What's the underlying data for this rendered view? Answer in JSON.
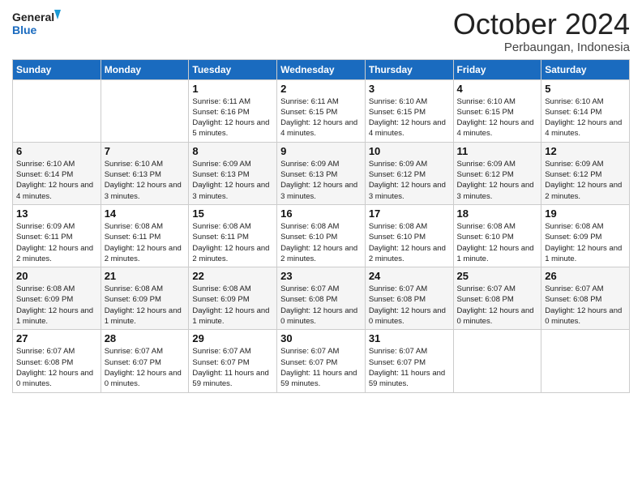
{
  "logo": {
    "line1": "General",
    "line2": "Blue"
  },
  "header": {
    "month": "October 2024",
    "location": "Perbaungan, Indonesia"
  },
  "weekdays": [
    "Sunday",
    "Monday",
    "Tuesday",
    "Wednesday",
    "Thursday",
    "Friday",
    "Saturday"
  ],
  "weeks": [
    [
      {
        "day": "",
        "info": ""
      },
      {
        "day": "",
        "info": ""
      },
      {
        "day": "1",
        "info": "Sunrise: 6:11 AM\nSunset: 6:16 PM\nDaylight: 12 hours and 5 minutes."
      },
      {
        "day": "2",
        "info": "Sunrise: 6:11 AM\nSunset: 6:15 PM\nDaylight: 12 hours and 4 minutes."
      },
      {
        "day": "3",
        "info": "Sunrise: 6:10 AM\nSunset: 6:15 PM\nDaylight: 12 hours and 4 minutes."
      },
      {
        "day": "4",
        "info": "Sunrise: 6:10 AM\nSunset: 6:15 PM\nDaylight: 12 hours and 4 minutes."
      },
      {
        "day": "5",
        "info": "Sunrise: 6:10 AM\nSunset: 6:14 PM\nDaylight: 12 hours and 4 minutes."
      }
    ],
    [
      {
        "day": "6",
        "info": "Sunrise: 6:10 AM\nSunset: 6:14 PM\nDaylight: 12 hours and 4 minutes."
      },
      {
        "day": "7",
        "info": "Sunrise: 6:10 AM\nSunset: 6:13 PM\nDaylight: 12 hours and 3 minutes."
      },
      {
        "day": "8",
        "info": "Sunrise: 6:09 AM\nSunset: 6:13 PM\nDaylight: 12 hours and 3 minutes."
      },
      {
        "day": "9",
        "info": "Sunrise: 6:09 AM\nSunset: 6:13 PM\nDaylight: 12 hours and 3 minutes."
      },
      {
        "day": "10",
        "info": "Sunrise: 6:09 AM\nSunset: 6:12 PM\nDaylight: 12 hours and 3 minutes."
      },
      {
        "day": "11",
        "info": "Sunrise: 6:09 AM\nSunset: 6:12 PM\nDaylight: 12 hours and 3 minutes."
      },
      {
        "day": "12",
        "info": "Sunrise: 6:09 AM\nSunset: 6:12 PM\nDaylight: 12 hours and 2 minutes."
      }
    ],
    [
      {
        "day": "13",
        "info": "Sunrise: 6:09 AM\nSunset: 6:11 PM\nDaylight: 12 hours and 2 minutes."
      },
      {
        "day": "14",
        "info": "Sunrise: 6:08 AM\nSunset: 6:11 PM\nDaylight: 12 hours and 2 minutes."
      },
      {
        "day": "15",
        "info": "Sunrise: 6:08 AM\nSunset: 6:11 PM\nDaylight: 12 hours and 2 minutes."
      },
      {
        "day": "16",
        "info": "Sunrise: 6:08 AM\nSunset: 6:10 PM\nDaylight: 12 hours and 2 minutes."
      },
      {
        "day": "17",
        "info": "Sunrise: 6:08 AM\nSunset: 6:10 PM\nDaylight: 12 hours and 2 minutes."
      },
      {
        "day": "18",
        "info": "Sunrise: 6:08 AM\nSunset: 6:10 PM\nDaylight: 12 hours and 1 minute."
      },
      {
        "day": "19",
        "info": "Sunrise: 6:08 AM\nSunset: 6:09 PM\nDaylight: 12 hours and 1 minute."
      }
    ],
    [
      {
        "day": "20",
        "info": "Sunrise: 6:08 AM\nSunset: 6:09 PM\nDaylight: 12 hours and 1 minute."
      },
      {
        "day": "21",
        "info": "Sunrise: 6:08 AM\nSunset: 6:09 PM\nDaylight: 12 hours and 1 minute."
      },
      {
        "day": "22",
        "info": "Sunrise: 6:08 AM\nSunset: 6:09 PM\nDaylight: 12 hours and 1 minute."
      },
      {
        "day": "23",
        "info": "Sunrise: 6:07 AM\nSunset: 6:08 PM\nDaylight: 12 hours and 0 minutes."
      },
      {
        "day": "24",
        "info": "Sunrise: 6:07 AM\nSunset: 6:08 PM\nDaylight: 12 hours and 0 minutes."
      },
      {
        "day": "25",
        "info": "Sunrise: 6:07 AM\nSunset: 6:08 PM\nDaylight: 12 hours and 0 minutes."
      },
      {
        "day": "26",
        "info": "Sunrise: 6:07 AM\nSunset: 6:08 PM\nDaylight: 12 hours and 0 minutes."
      }
    ],
    [
      {
        "day": "27",
        "info": "Sunrise: 6:07 AM\nSunset: 6:08 PM\nDaylight: 12 hours and 0 minutes."
      },
      {
        "day": "28",
        "info": "Sunrise: 6:07 AM\nSunset: 6:07 PM\nDaylight: 12 hours and 0 minutes."
      },
      {
        "day": "29",
        "info": "Sunrise: 6:07 AM\nSunset: 6:07 PM\nDaylight: 11 hours and 59 minutes."
      },
      {
        "day": "30",
        "info": "Sunrise: 6:07 AM\nSunset: 6:07 PM\nDaylight: 11 hours and 59 minutes."
      },
      {
        "day": "31",
        "info": "Sunrise: 6:07 AM\nSunset: 6:07 PM\nDaylight: 11 hours and 59 minutes."
      },
      {
        "day": "",
        "info": ""
      },
      {
        "day": "",
        "info": ""
      }
    ]
  ]
}
